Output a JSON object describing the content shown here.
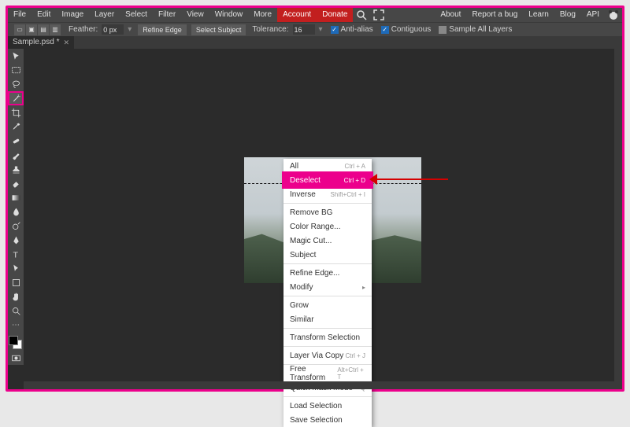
{
  "menubar": {
    "items": [
      "File",
      "Edit",
      "Image",
      "Layer",
      "Select",
      "Filter",
      "View",
      "Window",
      "More"
    ],
    "account": "Account",
    "donate": "Donate",
    "right": [
      "About",
      "Report a bug",
      "Learn",
      "Blog",
      "API"
    ]
  },
  "optbar": {
    "feather_label": "Feather:",
    "feather_value": "0 px",
    "refine_edge": "Refine Edge",
    "select_subject": "Select Subject",
    "tolerance_label": "Tolerance:",
    "tolerance_value": "16",
    "antialias": "Anti-alias",
    "contiguous": "Contiguous",
    "sample_all": "Sample All Layers"
  },
  "tab": {
    "name": "Sample.psd *"
  },
  "tools": [
    "move",
    "rect-select",
    "lasso",
    "magic-wand",
    "crop",
    "eyedropper",
    "heal",
    "brush",
    "stamp",
    "eraser",
    "gradient",
    "blur",
    "dodge",
    "pen",
    "text",
    "path-select",
    "rectangle",
    "hand",
    "zoom"
  ],
  "context_menu": [
    {
      "label": "All",
      "shortcut": "Ctrl + A"
    },
    {
      "label": "Deselect",
      "shortcut": "Ctrl + D",
      "highlight": true
    },
    {
      "label": "Inverse",
      "shortcut": "Shift+Ctrl + I"
    },
    {
      "sep": true
    },
    {
      "label": "Remove BG"
    },
    {
      "label": "Color Range..."
    },
    {
      "label": "Magic Cut..."
    },
    {
      "label": "Subject"
    },
    {
      "sep": true
    },
    {
      "label": "Refine Edge..."
    },
    {
      "label": "Modify",
      "sub": true
    },
    {
      "sep": true
    },
    {
      "label": "Grow"
    },
    {
      "label": "Similar"
    },
    {
      "sep": true
    },
    {
      "label": "Transform Selection"
    },
    {
      "sep": true
    },
    {
      "label": "Layer Via Copy",
      "shortcut": "Ctrl + J"
    },
    {
      "sep": true
    },
    {
      "label": "Free Transform",
      "shortcut": "Alt+Ctrl + T"
    },
    {
      "label": "Quick Mask Mode",
      "shortcut": "Q"
    },
    {
      "sep": true
    },
    {
      "label": "Load Selection"
    },
    {
      "label": "Save Selection"
    }
  ]
}
